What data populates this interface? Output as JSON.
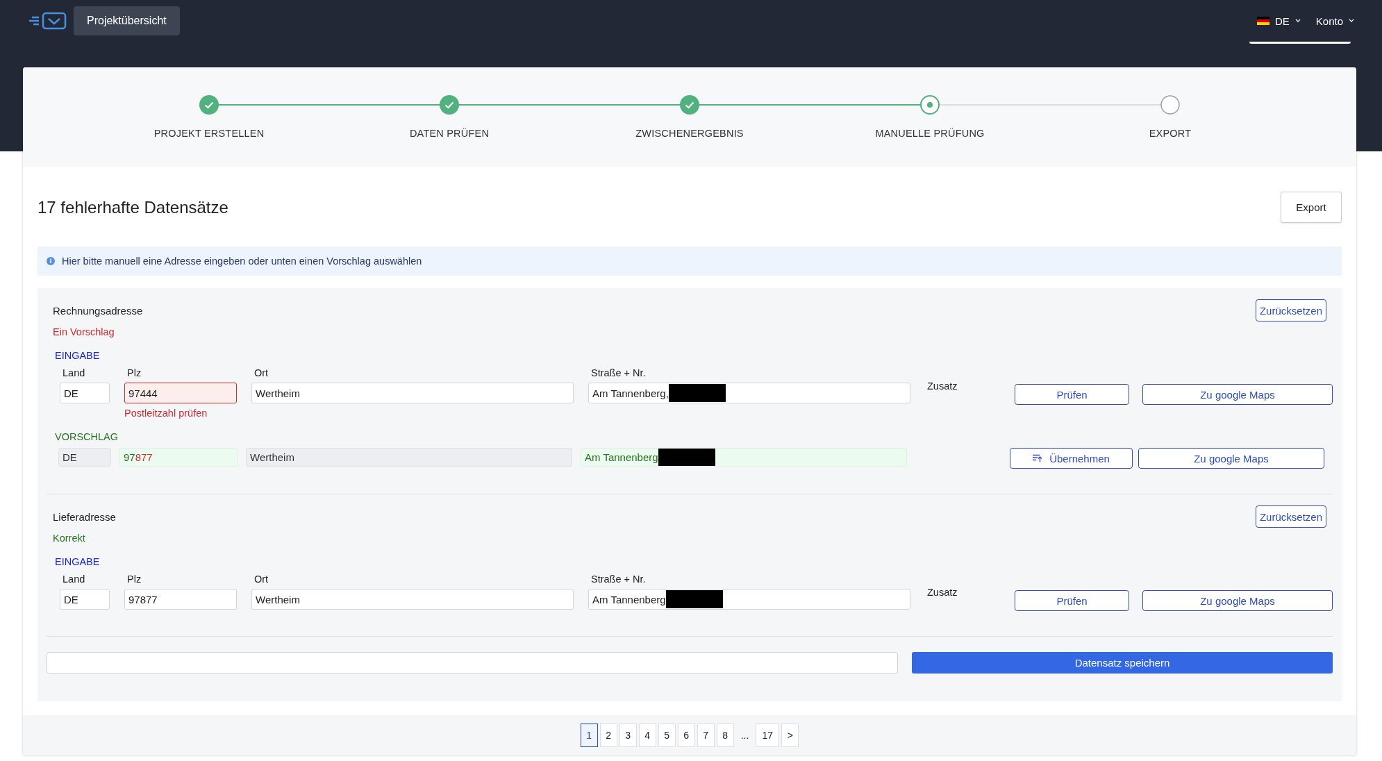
{
  "header": {
    "nav_button": "Projektübersicht",
    "language": "DE",
    "account": "Konto"
  },
  "steps": [
    {
      "label": "PROJEKT ERSTELLEN",
      "kind": "done"
    },
    {
      "label": "DATEN PRÜFEN",
      "kind": "done"
    },
    {
      "label": "ZWISCHENERGEBNIS",
      "kind": "done"
    },
    {
      "label": "MANUELLE PRÜFUNG",
      "kind": "current"
    },
    {
      "label": "EXPORT",
      "kind": "pending"
    }
  ],
  "heading": "17 fehlerhafte Datensätze",
  "export_button": "Export",
  "info": "Hier bitte manuell eine Adresse eingeben oder unten einen Vorschlag auswählen",
  "addresses": [
    {
      "title": "Rechnungsadresse",
      "status": "Ein Vorschlag",
      "valid": false,
      "reset_button": "Zurücksetzen",
      "input": {
        "section": "EINGABE",
        "extra_label": "Zusatz",
        "check_button": "Prüfen",
        "maps_button": "Zu google Maps",
        "fields": [
          {
            "label": "Land",
            "value": "DE",
            "invalid": false,
            "redacted": false
          },
          {
            "label": "Plz",
            "value": "97444",
            "invalid": true,
            "error": "Postleitzahl prüfen",
            "redacted": false
          },
          {
            "label": "Ort",
            "value": "Wertheim",
            "invalid": false,
            "redacted": false
          },
          {
            "label": "Straße + Nr.",
            "value": "Am Tannenberg,",
            "invalid": false,
            "redacted": true
          }
        ]
      },
      "suggestion": {
        "section": "VORSCHLAG",
        "apply_button": "Übernehmen",
        "maps_button": "Zu google Maps",
        "fields": [
          {
            "changed": false,
            "redacted": false,
            "parts": [
              {
                "text": "DE",
                "differs": false
              }
            ]
          },
          {
            "changed": true,
            "redacted": false,
            "parts": [
              {
                "text": "97",
                "differs": false
              },
              {
                "text": "877",
                "differs": true
              }
            ]
          },
          {
            "changed": false,
            "redacted": false,
            "parts": [
              {
                "text": "Wertheim",
                "differs": false
              }
            ]
          },
          {
            "changed": true,
            "redacted": true,
            "parts": [
              {
                "text": "Am Tannenberg",
                "differs": false
              }
            ]
          }
        ]
      }
    },
    {
      "title": "Lieferadresse",
      "status": "Korrekt",
      "valid": true,
      "reset_button": "Zurücksetzen",
      "input": {
        "section": "EINGABE",
        "extra_label": "Zusatz",
        "check_button": "Prüfen",
        "maps_button": "Zu google Maps",
        "fields": [
          {
            "label": "Land",
            "value": "DE",
            "invalid": false,
            "redacted": false
          },
          {
            "label": "Plz",
            "value": "97877",
            "invalid": false,
            "redacted": false
          },
          {
            "label": "Ort",
            "value": "Wertheim",
            "invalid": false,
            "redacted": false
          },
          {
            "label": "Straße + Nr.",
            "value": "Am Tannenberg",
            "invalid": false,
            "redacted": true
          }
        ]
      }
    }
  ],
  "save_button": "Datensatz speichern",
  "pages": [
    {
      "label": "1",
      "kind": "page",
      "selected": true
    },
    {
      "label": "2",
      "kind": "page",
      "selected": false
    },
    {
      "label": "3",
      "kind": "page",
      "selected": false
    },
    {
      "label": "4",
      "kind": "page",
      "selected": false
    },
    {
      "label": "5",
      "kind": "page",
      "selected": false
    },
    {
      "label": "6",
      "kind": "page",
      "selected": false
    },
    {
      "label": "7",
      "kind": "page",
      "selected": false
    },
    {
      "label": "8",
      "kind": "page",
      "selected": false
    },
    {
      "label": "...",
      "kind": "ellipsis",
      "selected": false
    },
    {
      "label": "17",
      "kind": "page",
      "selected": false
    },
    {
      "label": ">",
      "kind": "next",
      "selected": false
    }
  ]
}
